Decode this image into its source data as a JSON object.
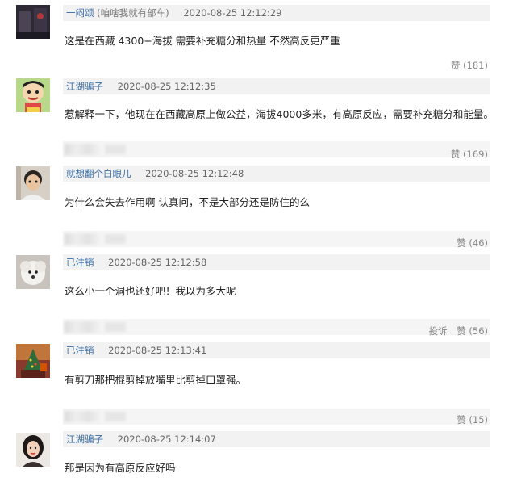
{
  "comments": [
    {
      "user": "一闷颂",
      "user_note": "(咱啥我就有部车)",
      "time": "2020-08-25 12:12:29",
      "text": "这是在西藏 4300+海拔 需要补充糖分和热量 不然高反更严重",
      "like": "赞 (181)"
    },
    {
      "user": "江湖骗子",
      "time": "2020-08-25 12:12:35",
      "text": "惹解释一下，他现在在西藏高原上做公益，海拔4000多米，有高原反应，需要补充糖分和能量。",
      "like": "赞 (169)"
    },
    {
      "user": "就想翻个白眼儿",
      "time": "2020-08-25 12:12:48",
      "text": "为什么会失去作用啊 认真问，不是大部分还是防住的么",
      "like": "赞 (46)"
    },
    {
      "user": "已注销",
      "time": "2020-08-25 12:12:58",
      "text": "这么小一个洞也还好吧！我以为多大呢",
      "report": "投诉",
      "like": "赞 (56)"
    },
    {
      "user": "已注销",
      "time": "2020-08-25 12:13:41",
      "text": "有剪刀那把棍剪掉放嘴里比剪掉口罩强。",
      "like": "赞 (15)"
    },
    {
      "user": "江湖骗子",
      "time": "2020-08-25 12:14:07",
      "text": "那是因为有高原反应好吗"
    }
  ],
  "avatars": [
    "dark-photo-icon",
    "cartoon-boy-icon",
    "child-photo-icon",
    "white-dog-icon",
    "christmas-tree-icon",
    "woman-portrait-icon"
  ],
  "colors": {
    "username": "#3b6ea5",
    "meta_bg": "#f2f2f2",
    "text": "#222222",
    "muted": "#888888"
  }
}
